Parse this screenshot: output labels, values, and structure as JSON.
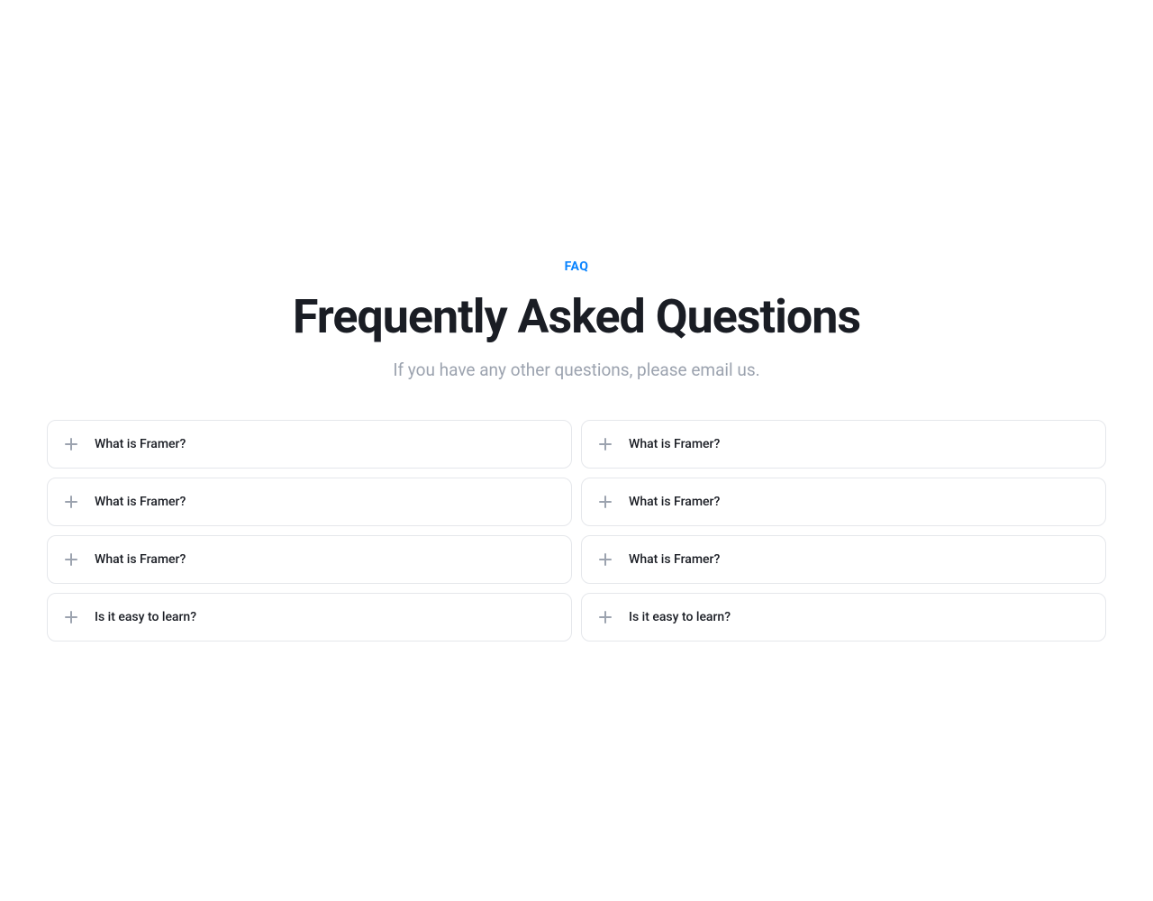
{
  "header": {
    "eyebrow": "FAQ",
    "title": "Frequently Asked Questions",
    "subtitle": "If you have any other questions, please email us."
  },
  "faq": {
    "left": [
      {
        "question": "What is Framer?"
      },
      {
        "question": "What is Framer?"
      },
      {
        "question": "What is Framer?"
      },
      {
        "question": "Is it easy to learn?"
      }
    ],
    "right": [
      {
        "question": "What is Framer?"
      },
      {
        "question": "What is Framer?"
      },
      {
        "question": "What is Framer?"
      },
      {
        "question": "Is it easy to learn?"
      }
    ]
  },
  "colors": {
    "accent": "#0a84ff",
    "text_primary": "#1a1d24",
    "text_muted": "#9ca3af",
    "border": "#e5e7eb"
  }
}
